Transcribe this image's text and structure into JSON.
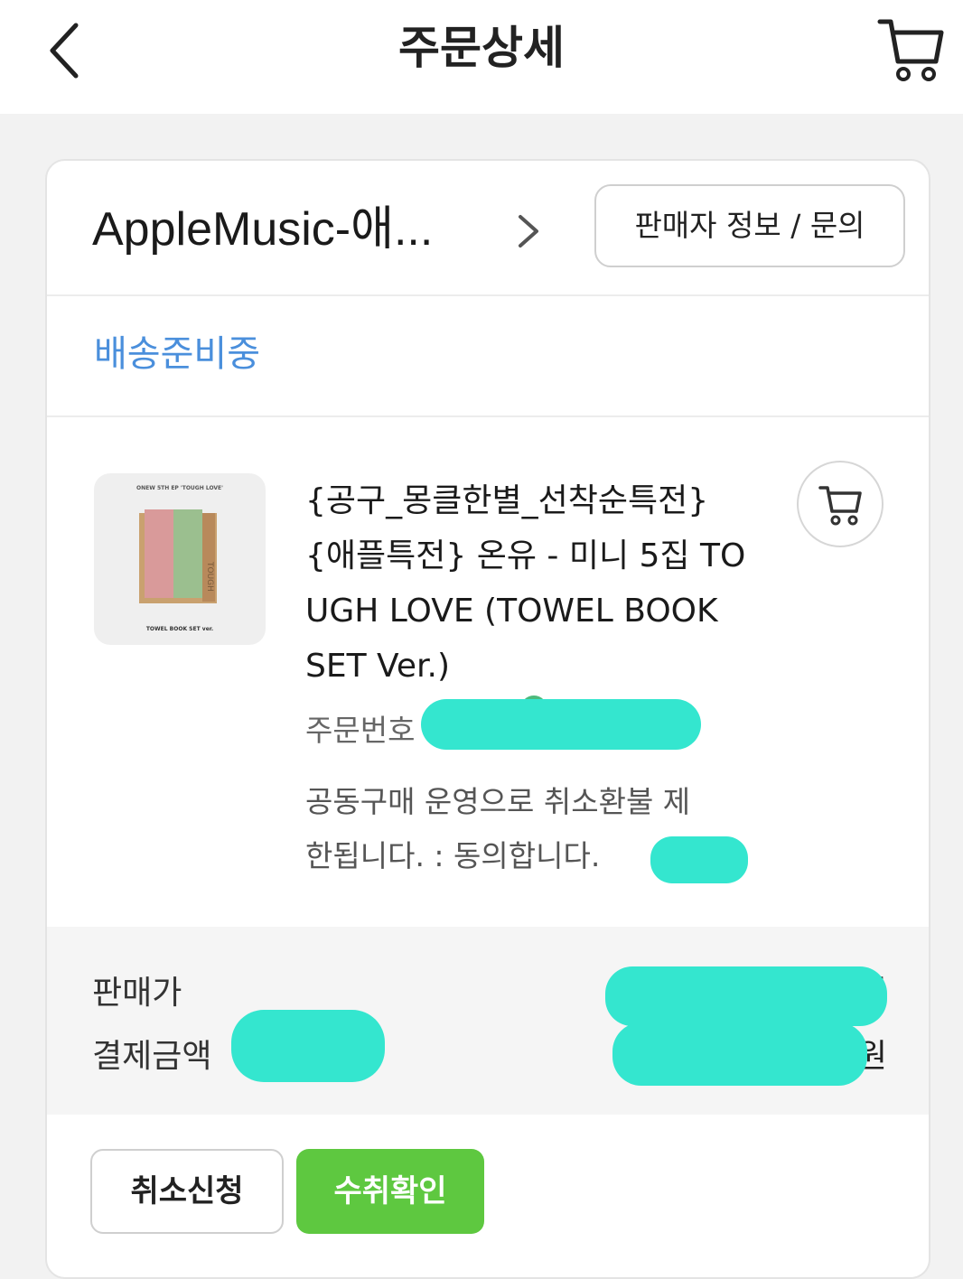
{
  "header": {
    "title": "주문상세",
    "back_icon": "chevron-left-icon",
    "cart_icon": "cart-icon"
  },
  "seller": {
    "name": "AppleMusic-애...",
    "info_button": "판매자 정보 / 문의"
  },
  "order": {
    "status": "배송준비중",
    "status_color": "#4a8fdc",
    "product": {
      "thumbnail_top": "ONEW 5TH EP 'TOUGH LOVE'",
      "thumbnail_bottom": "TOWEL BOOK SET ver.",
      "title_lines": [
        "{공구_몽클한별_선착순특전}",
        "{애플특전} 온유 - 미니 5집 TO",
        "UGH LOVE (TOWEL BOOK",
        "SET Ver.)"
      ]
    },
    "order_number_label": "주문번호",
    "notice_lines": [
      "공동구매 운영으로 취소환불 제",
      "한됩니다. : 동의합니다."
    ]
  },
  "price": {
    "sale_price_label": "판매가",
    "sale_price_suffix": "원",
    "payment_label": "결제금액",
    "payment_suffix": "원"
  },
  "actions": {
    "cancel": "취소신청",
    "confirm": "수취확인",
    "confirm_color": "#5ec840"
  }
}
